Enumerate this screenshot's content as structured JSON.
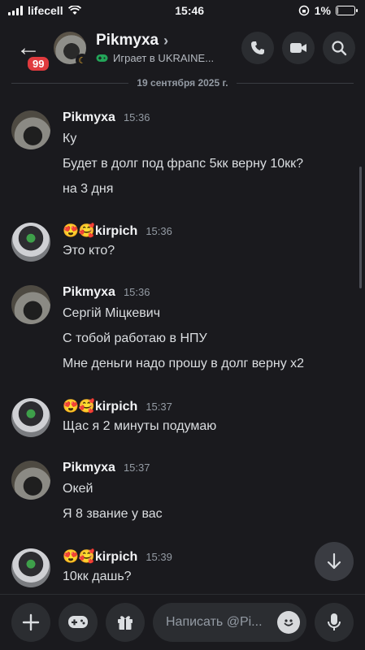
{
  "status_bar": {
    "carrier": "lifecell",
    "time": "15:46",
    "battery": "1%",
    "battery_level": 0.01
  },
  "header": {
    "back_badge": "99",
    "name": "Pikmyxa",
    "activity": "Играет в UKRAINE..."
  },
  "date_divider": "19 сентября 2025 г.",
  "messages": [
    {
      "author": "Pikmyxa",
      "time": "15:36",
      "lines": [
        "Ку",
        "Будет в долг под фрапс 5кк верну 10кк?",
        "на 3 дня"
      ]
    },
    {
      "author": "😍🥰kirpich",
      "time": "15:36",
      "lines": [
        "Это кто?"
      ]
    },
    {
      "author": "Pikmyxa",
      "time": "15:36",
      "lines": [
        "Сергій Міцкевич",
        "С тобой работаю в НПУ",
        "Мне деньги надо прошу в долг верну х2"
      ]
    },
    {
      "author": "😍🥰kirpich",
      "time": "15:37",
      "lines": [
        "Щас я 2 минуты подумаю"
      ]
    },
    {
      "author": "Pikmyxa",
      "time": "15:37",
      "lines": [
        "Окей",
        "Я 8 звание у вас"
      ]
    },
    {
      "author": "😍🥰kirpich",
      "time": "15:39",
      "lines": [
        "10кк дашь?"
      ]
    }
  ],
  "composer": {
    "placeholder": "Написать @Pi..."
  }
}
